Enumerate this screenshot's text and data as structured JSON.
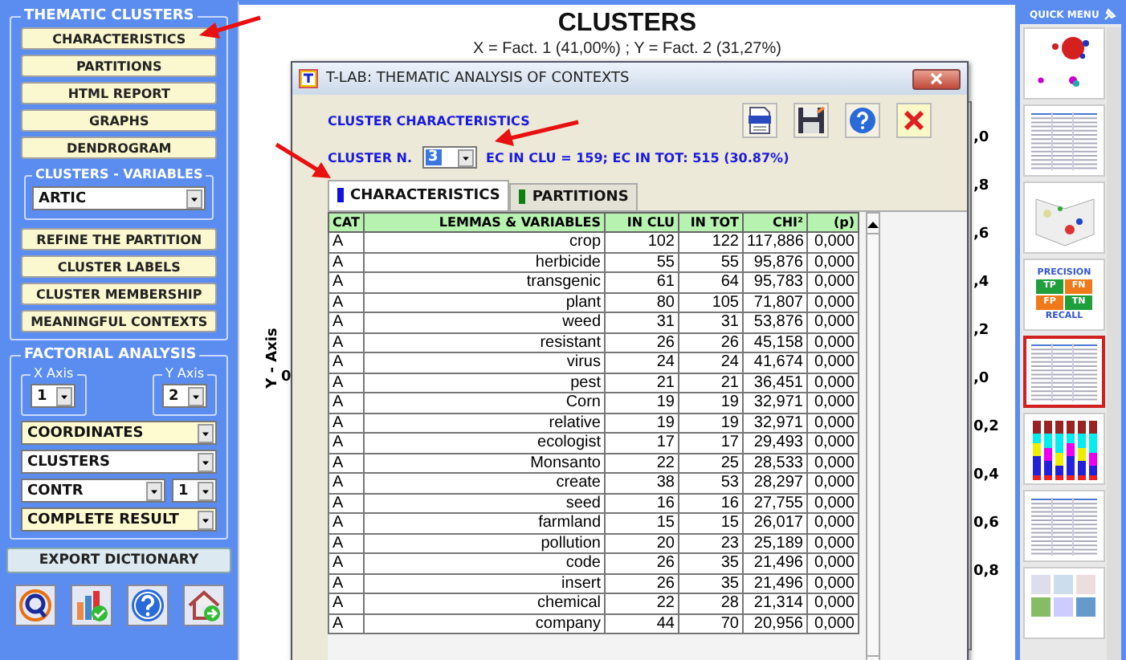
{
  "left_panel": {
    "thematic_clusters": {
      "title": "THEMATIC CLUSTERS",
      "buttons": [
        "CHARACTERISTICS",
        "PARTITIONS",
        "HTML REPORT",
        "GRAPHS",
        "DENDROGRAM"
      ],
      "variables_group": {
        "title": "CLUSTERS - VARIABLES",
        "value": "ARTIC"
      },
      "more_buttons": [
        "REFINE THE PARTITION",
        "CLUSTER LABELS",
        "CLUSTER MEMBERSHIP",
        "MEANINGFUL CONTEXTS"
      ]
    },
    "factorial_analysis": {
      "title": "FACTORIAL ANALYSIS",
      "x_axis": {
        "title": "X Axis",
        "value": "1"
      },
      "y_axis": {
        "title": "Y Axis",
        "value": "2"
      },
      "select_rows": [
        [
          {
            "value": "COORDINATES",
            "highlighted": true
          }
        ],
        [
          {
            "value": "CLUSTERS",
            "highlighted": false
          }
        ],
        [
          {
            "value": "CONTR",
            "highlighted": false
          },
          {
            "value": "1",
            "highlighted": false
          }
        ],
        [
          {
            "value": "COMPLETE RESULT",
            "highlighted": true
          }
        ]
      ]
    },
    "export_button": "EXPORT DICTIONARY"
  },
  "chart": {
    "title": "CLUSTERS",
    "subtitle": "X = Fact. 1 (41,00%) ; Y = Fact. 2 (31,27%)",
    "y_axis_label": "Y - Axis",
    "left_tick": "0",
    "right_ticks": [
      ",0",
      ",8",
      ",6",
      ",4",
      ",2",
      ",0",
      "0,2",
      "0,4",
      "0,6",
      "0,8"
    ]
  },
  "dialog": {
    "title": "T-LAB: THEMATIC ANALYSIS OF CONTEXTS",
    "heading": "CLUSTER CHARACTERISTICS",
    "cluster_label": "CLUSTER N.",
    "cluster_value": "3",
    "info": "EC IN CLU = 159; EC IN TOT: 515 (30.87%)",
    "tabs": [
      {
        "label": "CHARACTERISTICS",
        "selected": true,
        "color": "#1010e0"
      },
      {
        "label": "PARTITIONS",
        "selected": false,
        "color": "#108010"
      }
    ],
    "table": {
      "columns": [
        "CAT",
        "LEMMAS & VARIABLES",
        "IN CLU",
        "IN TOT",
        "CHI²",
        "(p)"
      ],
      "rows": [
        [
          "A",
          "crop",
          "102",
          "122",
          "117,886",
          "0,000"
        ],
        [
          "A",
          "herbicide",
          "55",
          "55",
          "95,876",
          "0,000"
        ],
        [
          "A",
          "transgenic",
          "61",
          "64",
          "95,783",
          "0,000"
        ],
        [
          "A",
          "plant",
          "80",
          "105",
          "71,807",
          "0,000"
        ],
        [
          "A",
          "weed",
          "31",
          "31",
          "53,876",
          "0,000"
        ],
        [
          "A",
          "resistant",
          "26",
          "26",
          "45,158",
          "0,000"
        ],
        [
          "A",
          "virus",
          "24",
          "24",
          "41,674",
          "0,000"
        ],
        [
          "A",
          "pest",
          "21",
          "21",
          "36,451",
          "0,000"
        ],
        [
          "A",
          "Corn",
          "19",
          "19",
          "32,971",
          "0,000"
        ],
        [
          "A",
          "relative",
          "19",
          "19",
          "32,971",
          "0,000"
        ],
        [
          "A",
          "ecologist",
          "17",
          "17",
          "29,493",
          "0,000"
        ],
        [
          "A",
          "Monsanto",
          "22",
          "25",
          "28,533",
          "0,000"
        ],
        [
          "A",
          "create",
          "38",
          "53",
          "28,297",
          "0,000"
        ],
        [
          "A",
          "seed",
          "16",
          "16",
          "27,755",
          "0,000"
        ],
        [
          "A",
          "farmland",
          "15",
          "15",
          "26,017",
          "0,000"
        ],
        [
          "A",
          "pollution",
          "20",
          "23",
          "25,189",
          "0,000"
        ],
        [
          "A",
          "code",
          "26",
          "35",
          "21,496",
          "0,000"
        ],
        [
          "A",
          "insert",
          "26",
          "35",
          "21,496",
          "0,000"
        ],
        [
          "A",
          "chemical",
          "22",
          "28",
          "21,314",
          "0,000"
        ],
        [
          "A",
          "company",
          "44",
          "70",
          "20,956",
          "0,000"
        ]
      ]
    }
  },
  "quick_menu": {
    "title": "QUICK MENU",
    "thumbnails": [
      {
        "kind": "bubbles",
        "selected": false
      },
      {
        "kind": "table",
        "selected": false
      },
      {
        "kind": "scatter",
        "selected": false
      },
      {
        "kind": "matrix",
        "selected": false,
        "heading": "PRECISION",
        "cells": [
          "TP",
          "FN",
          "FP",
          "TN"
        ],
        "footer": "RECALL"
      },
      {
        "kind": "table",
        "selected": true
      },
      {
        "kind": "bars",
        "selected": false
      },
      {
        "kind": "table",
        "selected": false
      },
      {
        "kind": "maps",
        "selected": false
      }
    ]
  }
}
